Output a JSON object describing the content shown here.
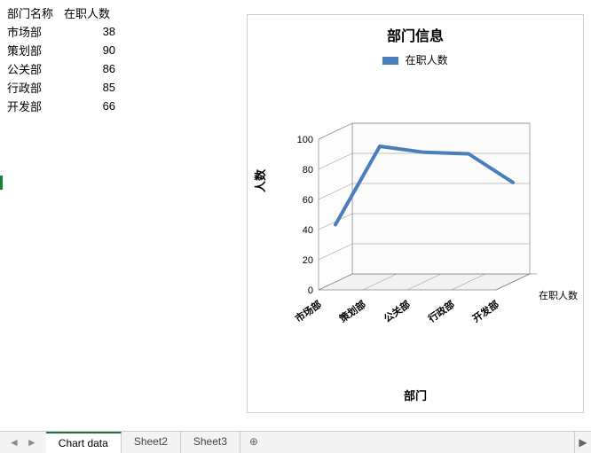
{
  "table": {
    "headers": [
      "部门名称",
      "在职人数"
    ],
    "rows": [
      {
        "dept": "市场部",
        "count": 38
      },
      {
        "dept": "策划部",
        "count": 90
      },
      {
        "dept": "公关部",
        "count": 86
      },
      {
        "dept": "行政部",
        "count": 85
      },
      {
        "dept": "开发部",
        "count": 66
      }
    ]
  },
  "chart": {
    "title": "部门信息",
    "legend_label": "在职人数",
    "ylabel": "人数",
    "xlabel": "部门",
    "depth_label": "在职人数",
    "yticks": [
      0,
      20,
      40,
      60,
      80,
      100
    ],
    "categories": [
      "市场部",
      "策划部",
      "公关部",
      "行政部",
      "开发部"
    ]
  },
  "tabs": {
    "items": [
      "Chart data",
      "Sheet2",
      "Sheet3"
    ],
    "active_index": 0,
    "add_icon": "⊕",
    "prev_icon": "◄",
    "next_icon": "►",
    "scroll_icon": "▶"
  },
  "colors": {
    "series": "#4a7ebb",
    "axis": "#888",
    "excel_green": "#217346"
  },
  "chart_data": {
    "type": "line",
    "title": "部门信息",
    "xlabel": "部门",
    "ylabel": "人数",
    "ylim": [
      0,
      100
    ],
    "categories": [
      "市场部",
      "策划部",
      "公关部",
      "行政部",
      "开发部"
    ],
    "series": [
      {
        "name": "在职人数",
        "values": [
          38,
          90,
          86,
          85,
          66
        ]
      }
    ],
    "legend": {
      "position": "top",
      "entries": [
        "在职人数"
      ]
    }
  }
}
